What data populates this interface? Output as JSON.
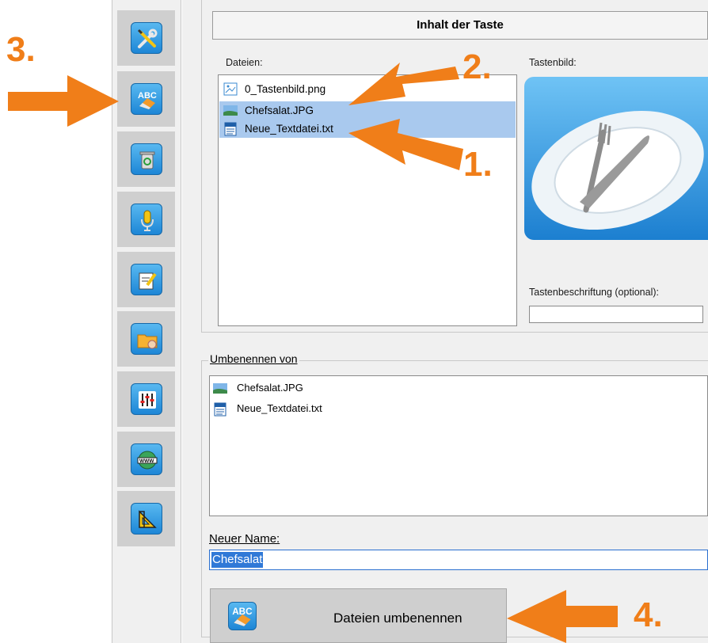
{
  "toolbar": {
    "items": [
      {
        "icon": "wrench-screwdriver-icon"
      },
      {
        "icon": "abc-eraser-icon"
      },
      {
        "icon": "recycle-bin-icon"
      },
      {
        "icon": "microphone-icon"
      },
      {
        "icon": "edit-note-icon"
      },
      {
        "icon": "folder-hand-icon"
      },
      {
        "icon": "mixer-sliders-icon"
      },
      {
        "icon": "globe-www-icon"
      },
      {
        "icon": "ruler-triangle-icon"
      }
    ]
  },
  "panel": {
    "title": "Inhalt der Taste",
    "files_label": "Dateien:",
    "files": [
      {
        "name": "0_Tastenbild.png",
        "type": "image",
        "selected": false
      },
      {
        "name": "Chefsalat.JPG",
        "type": "photo",
        "selected": true
      },
      {
        "name": "Neue_Textdatei.txt",
        "type": "text",
        "selected": true
      }
    ],
    "preview_label": "Tastenbild:",
    "caption_label": "Tastenbeschriftung (optional):",
    "caption_value": ""
  },
  "rename": {
    "legend": "Umbenennen von",
    "items": [
      {
        "name": "Chefsalat.JPG",
        "type": "photo"
      },
      {
        "name": "Neue_Textdatei.txt",
        "type": "text"
      }
    ],
    "new_name_label": "Neuer Name:",
    "new_name_value": "Chefsalat",
    "button_label": "Dateien umbenennen"
  },
  "annotations": {
    "step1": "1.",
    "step2": "2.",
    "step3": "3.",
    "step4": "4.",
    "arrow_color": "#f07e19"
  },
  "colors": {
    "selection": "#a9c9ee",
    "icon_blue": "#1d86d6",
    "input_highlight": "#3079d7"
  }
}
